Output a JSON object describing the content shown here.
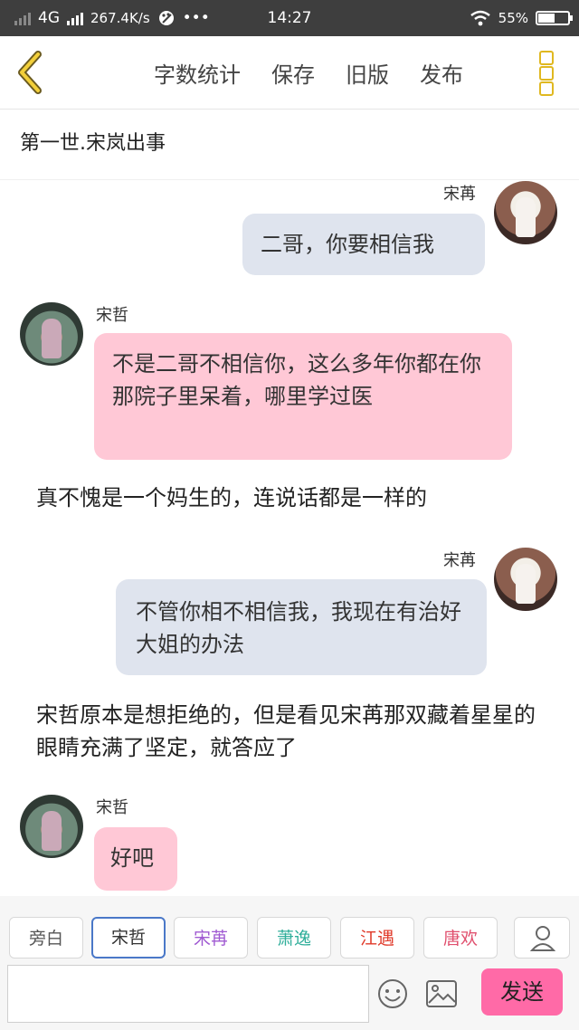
{
  "status_bar": {
    "network": "4G",
    "speed": "267.4K/s",
    "more": "•••",
    "time": "14:27",
    "battery": "55%",
    "battery_level": 0.55
  },
  "nav": {
    "word_count": "字数统计",
    "save": "保存",
    "old_version": "旧版",
    "publish": "发布"
  },
  "chapter_title": "第一世.宋岚出事",
  "messages": [
    {
      "speaker": "宋苒",
      "text": "二哥，你要相信我"
    },
    {
      "speaker": "宋哲",
      "text": "不是二哥不相信你，这么多年你都在你那院子里呆着，哪里学过医"
    },
    {
      "narration": "真不愧是一个妈生的，连说话都是一样的"
    },
    {
      "speaker": "宋苒",
      "text": "不管你相不相信我，我现在有治好大姐的办法"
    },
    {
      "narration": "宋哲原本是想拒绝的，但是看见宋苒那双藏着星星的眼睛充满了坚定，就答应了"
    },
    {
      "speaker": "宋哲",
      "text": "好吧"
    }
  ],
  "characters": [
    {
      "label": "旁白",
      "color": "#555555"
    },
    {
      "label": "宋哲",
      "color": "#333333"
    },
    {
      "label": "宋苒",
      "color": "#a05ad2"
    },
    {
      "label": "萧逸",
      "color": "#2fae9a"
    },
    {
      "label": "江遇",
      "color": "#e03a2a"
    },
    {
      "label": "唐欢",
      "color": "#e0506e"
    }
  ],
  "input": {
    "send_label": "发送"
  },
  "colors": {
    "accent": "#ff6aa7",
    "selected_border": "#4a78c8",
    "menu_dots": "#e0b820"
  }
}
